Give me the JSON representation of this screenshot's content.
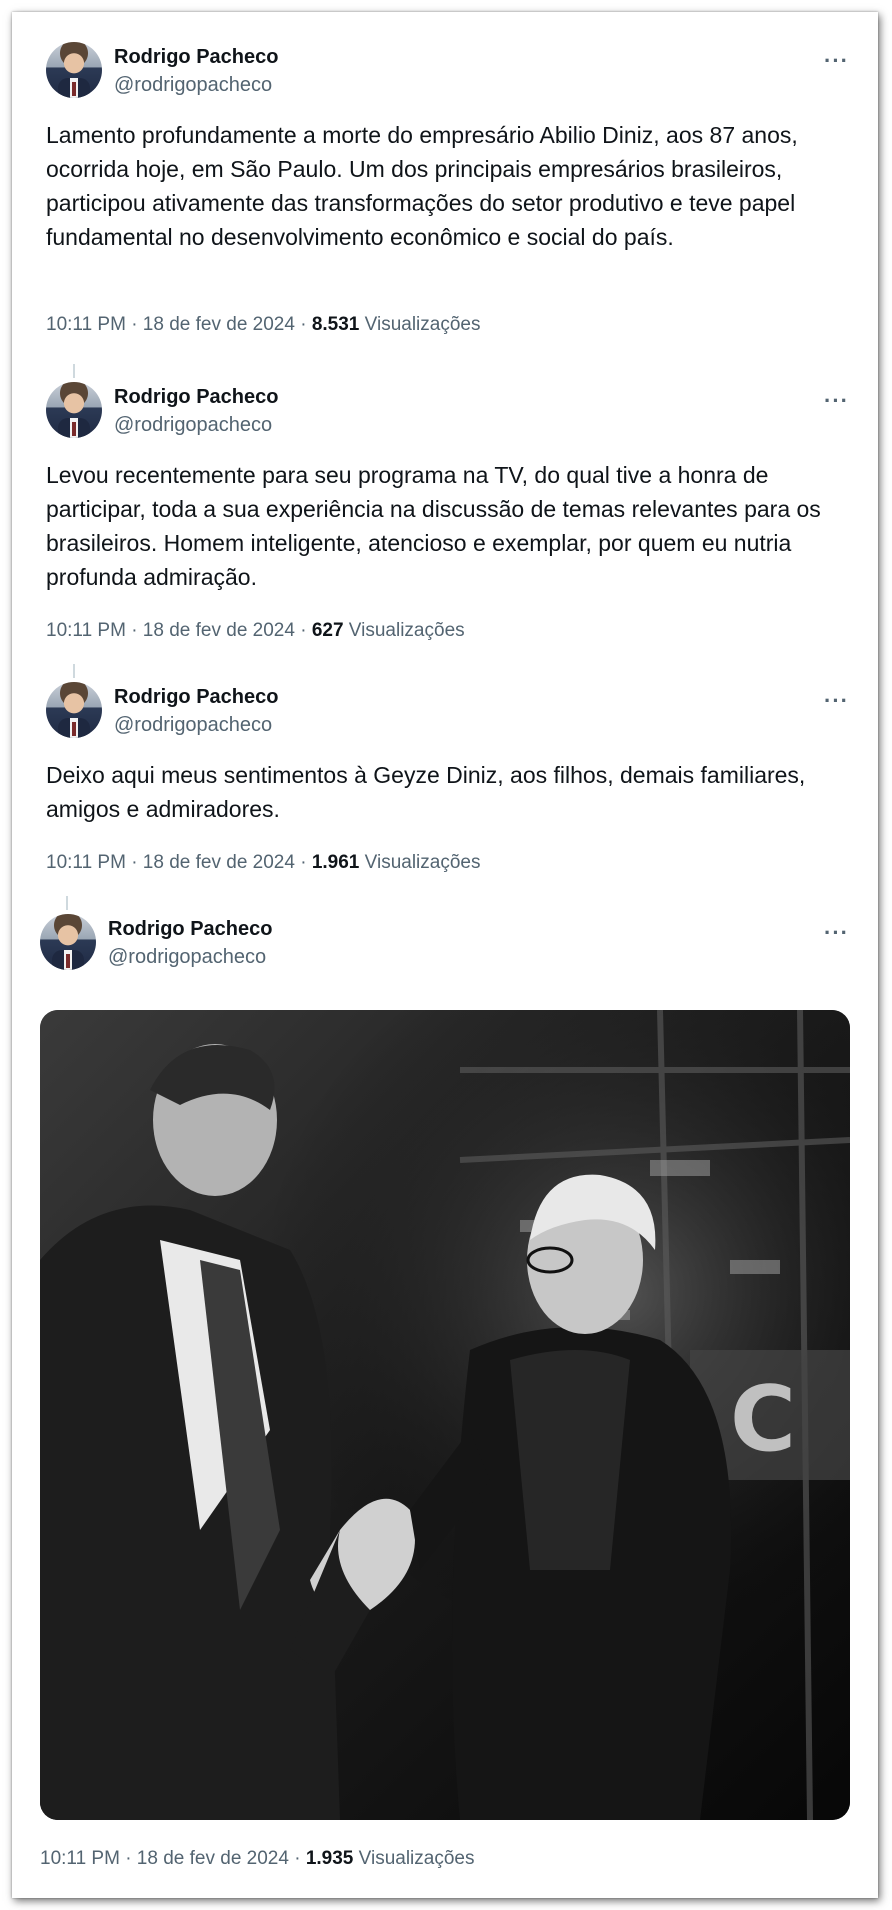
{
  "author": {
    "name": "Rodrigo Pacheco",
    "handle": "@rodrigopacheco"
  },
  "more_glyph": "···",
  "tweets": [
    {
      "text": "Lamento profundamente a morte do empresário Abilio Diniz, aos 87 anos, ocorrida hoje, em São Paulo. Um dos principais empresários brasileiros, participou ativamente das transformações do setor produtivo e teve papel fundamental no desenvolvimento econômico e social do país.",
      "time": "10:11 PM · 18 de fev de 2024 · ",
      "views": "8.531",
      "views_label": " Visualizações"
    },
    {
      "text": "Levou recentemente para seu programa na TV, do qual tive a honra de participar, toda a sua experiência na discussão de temas relevantes para os brasileiros. Homem inteligente, atencioso e exemplar, por quem eu nutria profunda admiração.",
      "time": "10:11 PM · 18 de fev de 2024 · ",
      "views": "627",
      "views_label": " Visualizações"
    },
    {
      "text": "Deixo aqui meus sentimentos à Geyze Diniz, aos filhos, demais familiares, amigos e admiradores.",
      "time": "10:11 PM · 18 de fev de 2024 · ",
      "views": "1.961",
      "views_label": " Visualizações"
    },
    {
      "text": "",
      "time": "10:11 PM · 18 de fev de 2024 · ",
      "views": "1.935",
      "views_label": " Visualizações"
    }
  ],
  "colors": {
    "text_primary": "#0f1419",
    "text_secondary": "#536471",
    "thread_line": "#cfd9de"
  }
}
